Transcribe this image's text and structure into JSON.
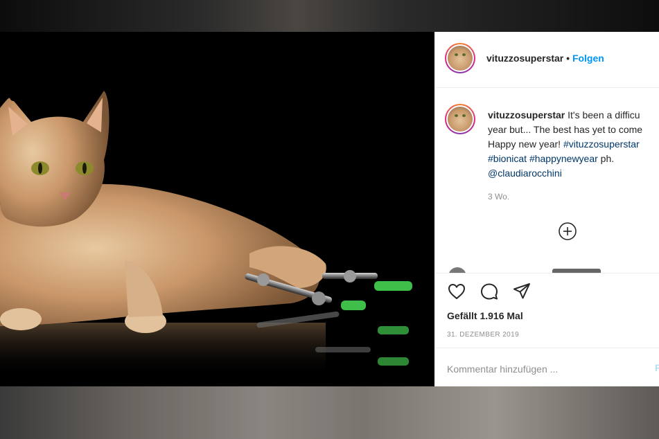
{
  "post": {
    "username": "vituzzosuperstar",
    "separator": "•",
    "follow_label": "Folgen",
    "caption": {
      "username": "vituzzosuperstar",
      "line1": " It's been a difficu",
      "line2": "year but... The best has yet to come",
      "line3_text": "Happy new year! ",
      "hashtag1": "#vituzzosuperstar",
      "hashtag2": "#bionicat",
      "hashtag3": "#happynewyear",
      "after_tags": " ph.",
      "mention": "@claudiarocchini"
    },
    "age": "3 Wo.",
    "likes": "Gefällt 1.916 Mal",
    "date": "31. DEZEMBER 2019",
    "comment_placeholder": "Kommentar hinzufügen ...",
    "post_label": "P"
  },
  "icons": {
    "heart": "heart-icon",
    "comment": "comment-icon",
    "share": "share-icon",
    "load_more": "plus-circle-icon"
  },
  "colors": {
    "follow_blue": "#0095f6",
    "hashtag": "#00376b",
    "muted": "#8e8e8e",
    "prosthesis_green": "#3fbf4a"
  }
}
